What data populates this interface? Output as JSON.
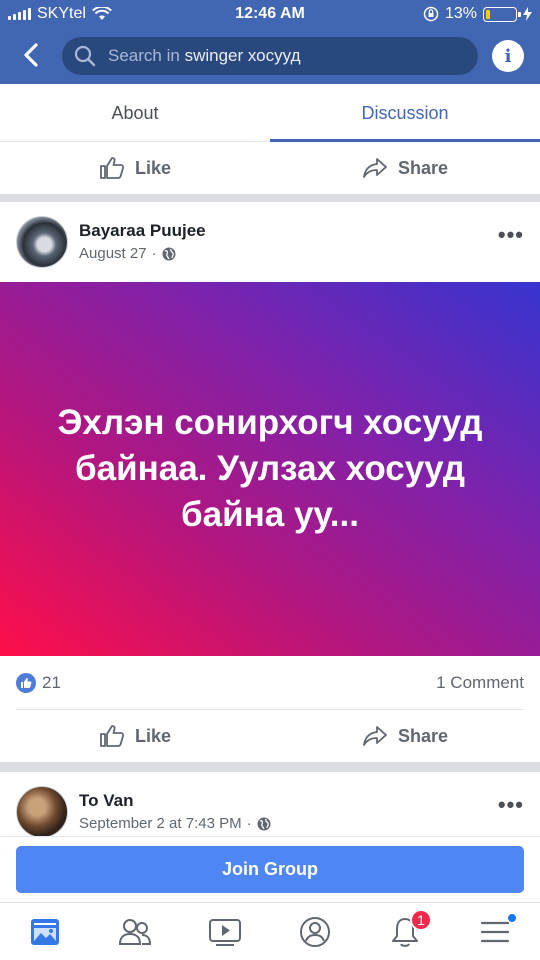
{
  "status_bar": {
    "carrier": "SKYtel",
    "time": "12:46 AM",
    "battery_percent": "13%",
    "battery_level": 0.13
  },
  "header": {
    "search_hint": "Search in",
    "search_group": "swinger хосууд",
    "info_icon": "i"
  },
  "tabs": [
    {
      "label": "About",
      "active": false
    },
    {
      "label": "Discussion",
      "active": true
    }
  ],
  "actions": {
    "like_label": "Like",
    "share_label": "Share"
  },
  "posts": [
    {
      "author": "Bayaraa Puujee",
      "date": "August 27",
      "separator": "·",
      "text": "Эхлэн сонирхогч хосууд байнаа. Уулзах хосууд байна уу...",
      "like_count": "21",
      "comment_count": "1 Comment",
      "more": "•••"
    },
    {
      "author": "To Van",
      "date": "September 2 at 7:43 PM",
      "separator": "·",
      "more": "•••"
    }
  ],
  "join_group": {
    "label": "Join Group"
  },
  "bottom_nav": {
    "items": [
      "news-feed-icon",
      "friends-icon",
      "watch-icon",
      "profile-icon",
      "notifications-icon",
      "menu-icon"
    ],
    "notifications_badge": "1"
  },
  "colors": {
    "brand": "#4267b2",
    "join_button": "#4e86f4",
    "badge": "#f02849"
  }
}
